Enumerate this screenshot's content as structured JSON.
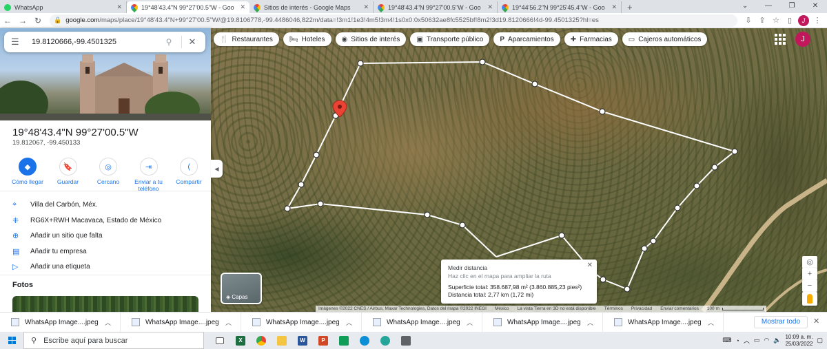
{
  "browser": {
    "tabs": [
      {
        "title": "WhatsApp",
        "favicon": "whatsapp-icon",
        "active": false
      },
      {
        "title": "19°48'43.4\"N 99°27'00.5\"W - Goo",
        "favicon": "google-maps-icon",
        "active": true
      },
      {
        "title": "Sitios de interés - Google Maps",
        "favicon": "google-maps-icon",
        "active": false
      },
      {
        "title": "19°48'43.4\"N 99°27'00.5\"W - Goo",
        "favicon": "google-maps-icon",
        "active": false
      },
      {
        "title": "19°44'56.2\"N 99°25'45.4\"W - Goo",
        "favicon": "google-maps-icon",
        "active": false
      }
    ],
    "url_host": "google.com",
    "url_rest": "/maps/place/19°48'43.4\"N+99°27'00.5\"W/@19.8106778,-99.4486046,822m/data=!3m1!1e3!4m5!3m4!1s0x0:0x50632ae8fc5525bf!8m2!3d19.8120666!4d-99.4501325?hl=es",
    "profile_initial": "J"
  },
  "search": {
    "value": "19.8120666,-99.4501325"
  },
  "place": {
    "title": "19°48'43.4\"N 99°27'00.5\"W",
    "subtitle": "19.812067, -99.450133",
    "actions": [
      {
        "label": "Cómo llegar",
        "icon": "directions-icon"
      },
      {
        "label": "Guardar",
        "icon": "bookmark-icon"
      },
      {
        "label": "Cercano",
        "icon": "nearby-icon"
      },
      {
        "label": "Enviar a tu teléfono",
        "icon": "send-to-phone-icon"
      },
      {
        "label": "Compartir",
        "icon": "share-icon"
      }
    ],
    "info": [
      {
        "text": "Villa del Carbón, Méx.",
        "icon": "location-pin-icon"
      },
      {
        "text": "RG6X+RWH Macavaca, Estado de México",
        "icon": "plus-code-icon"
      },
      {
        "text": "Añadir un sitio que falta",
        "icon": "add-place-icon"
      },
      {
        "text": "Añadir tu empresa",
        "icon": "add-business-icon"
      },
      {
        "text": "Añadir una etiqueta",
        "icon": "label-icon"
      }
    ],
    "fotos_label": "Fotos"
  },
  "chips": [
    {
      "label": "Restaurantes",
      "icon": "fork-knife-icon"
    },
    {
      "label": "Hoteles",
      "icon": "bed-icon"
    },
    {
      "label": "Sitios de interés",
      "icon": "camera-icon"
    },
    {
      "label": "Transporte público",
      "icon": "bus-icon"
    },
    {
      "label": "Aparcamientos",
      "icon": "parking-icon"
    },
    {
      "label": "Farmacias",
      "icon": "pharmacy-icon"
    },
    {
      "label": "Cajeros automáticos",
      "icon": "atm-icon"
    }
  ],
  "map": {
    "layers_label": "Capas",
    "measure": {
      "title": "Medir distancia",
      "hint": "Haz clic en el mapa para ampliar la ruta",
      "area": "Superficie total: 358.687,98 m² (3.860.885,23 pies²)",
      "distance": "Distancia total: 2,77 km (1,72 mi)"
    },
    "attribution": "Imágenes ©2022 CNES / Airbus, Maxar Technologies, Datos del mapa ©2022 INEGI",
    "links": [
      "México",
      "La vista Tierra en 3D no está disponible",
      "Términos",
      "Privacidad",
      "Enviar comentarios"
    ],
    "scale": "100 m"
  },
  "downloads": {
    "items": [
      "WhatsApp Image....jpeg",
      "WhatsApp Image....jpeg",
      "WhatsApp Image....jpeg",
      "WhatsApp Image....jpeg",
      "WhatsApp Image....jpeg",
      "WhatsApp Image....jpeg"
    ],
    "show_all": "Mostrar todo"
  },
  "taskbar": {
    "search_placeholder": "Escribe aquí para buscar",
    "time": "10:09 a. m.",
    "date": "25/03/2022"
  }
}
